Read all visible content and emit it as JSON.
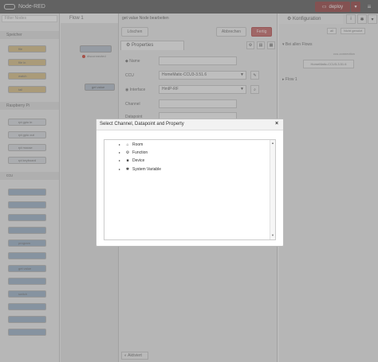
{
  "header": {
    "app_title": "Node-RED",
    "deploy_label": "deploy",
    "deploy_caret": "▾",
    "menu_icon": "menu-icon"
  },
  "palette": {
    "search_placeholder": "Filter Nodes",
    "categories": [
      "Speicher",
      "Raspberry Pi",
      "ccu"
    ],
    "nodes_speicher": [
      "file",
      "file in",
      "watch",
      "tail"
    ],
    "nodes_pi": [
      "rpi gpio in",
      "rpi gpio out",
      "rpi mouse",
      "rpi keyboard"
    ],
    "nodes_ccu": [
      "",
      "",
      "",
      "",
      "program",
      "",
      "get value",
      "",
      "switch",
      "",
      "",
      ""
    ]
  },
  "workspace": {
    "tab_label": "Flow 1",
    "node_a": "",
    "error_text": "disconnected",
    "node_b": "get value"
  },
  "tray": {
    "title": "get value Node bearbeiten",
    "delete_label": "Löschen",
    "cancel_label": "Abbrechen",
    "done_label": "Fertig",
    "properties_tab": "Properties",
    "fields": {
      "name_label": "Name",
      "ccu_label": "CCU",
      "ccu_value": "HomeMatic-CCU3-3.51.6",
      "interface_label": "Interface",
      "interface_value": "HmIP-RF",
      "channel_label": "Channel",
      "datapoint_label": "Datapoint"
    },
    "footer_toggle": "Aktiviert"
  },
  "sidebar": {
    "title": "Konfiguration",
    "info_icon": "i",
    "btn_all": "all",
    "btn_unused": "Nicht genutzt",
    "section_all_flows": "Bei allen Flows",
    "sub_ccu": "ccu-connection",
    "config_node": "HomeMatic-CCU3-3.51.6",
    "section_flow1": "Flow 1"
  },
  "dialog": {
    "title": "Select Channel, Datapoint and Property",
    "close_symbol": "×",
    "tree_items": [
      {
        "label": "Room",
        "icon": "home-icon",
        "glyph": "⌂"
      },
      {
        "label": "Function",
        "icon": "cogs-icon",
        "glyph": "⚙"
      },
      {
        "label": "Device",
        "icon": "cube-icon",
        "glyph": "■"
      },
      {
        "label": "System Variable",
        "icon": "gear-icon",
        "glyph": "✱"
      }
    ],
    "caret": "▸",
    "scroll_up": "▲",
    "scroll_down": "▼"
  }
}
